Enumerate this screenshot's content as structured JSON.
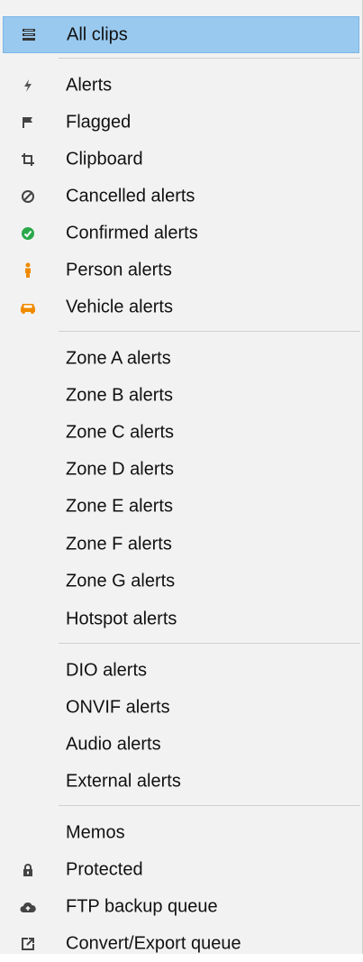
{
  "menu": {
    "items": [
      {
        "label": "All clips",
        "icon": "list-icon"
      },
      {
        "label": "Alerts",
        "icon": "lightning-icon"
      },
      {
        "label": "Flagged",
        "icon": "flag-icon"
      },
      {
        "label": "Clipboard",
        "icon": "crop-icon"
      },
      {
        "label": "Cancelled alerts",
        "icon": "cancel-icon"
      },
      {
        "label": "Confirmed alerts",
        "icon": "check-circle-icon",
        "color": "#2aa84a"
      },
      {
        "label": "Person alerts",
        "icon": "person-icon",
        "color": "#f08a00"
      },
      {
        "label": "Vehicle alerts",
        "icon": "car-icon",
        "color": "#f08a00"
      },
      {
        "label": "Zone A alerts"
      },
      {
        "label": "Zone B alerts"
      },
      {
        "label": "Zone C alerts"
      },
      {
        "label": "Zone D alerts"
      },
      {
        "label": "Zone E alerts"
      },
      {
        "label": "Zone F alerts"
      },
      {
        "label": "Zone G alerts"
      },
      {
        "label": "Hotspot alerts"
      },
      {
        "label": "DIO alerts"
      },
      {
        "label": "ONVIF alerts"
      },
      {
        "label": "Audio alerts"
      },
      {
        "label": "External alerts"
      },
      {
        "label": "Memos"
      },
      {
        "label": "Protected",
        "icon": "lock-icon"
      },
      {
        "label": "FTP backup queue",
        "icon": "cloud-upload-icon"
      },
      {
        "label": "Convert/Export queue",
        "icon": "export-icon"
      }
    ]
  },
  "colors": {
    "selected": "#99c9ef",
    "text": "#111111",
    "muted": "#555555"
  }
}
